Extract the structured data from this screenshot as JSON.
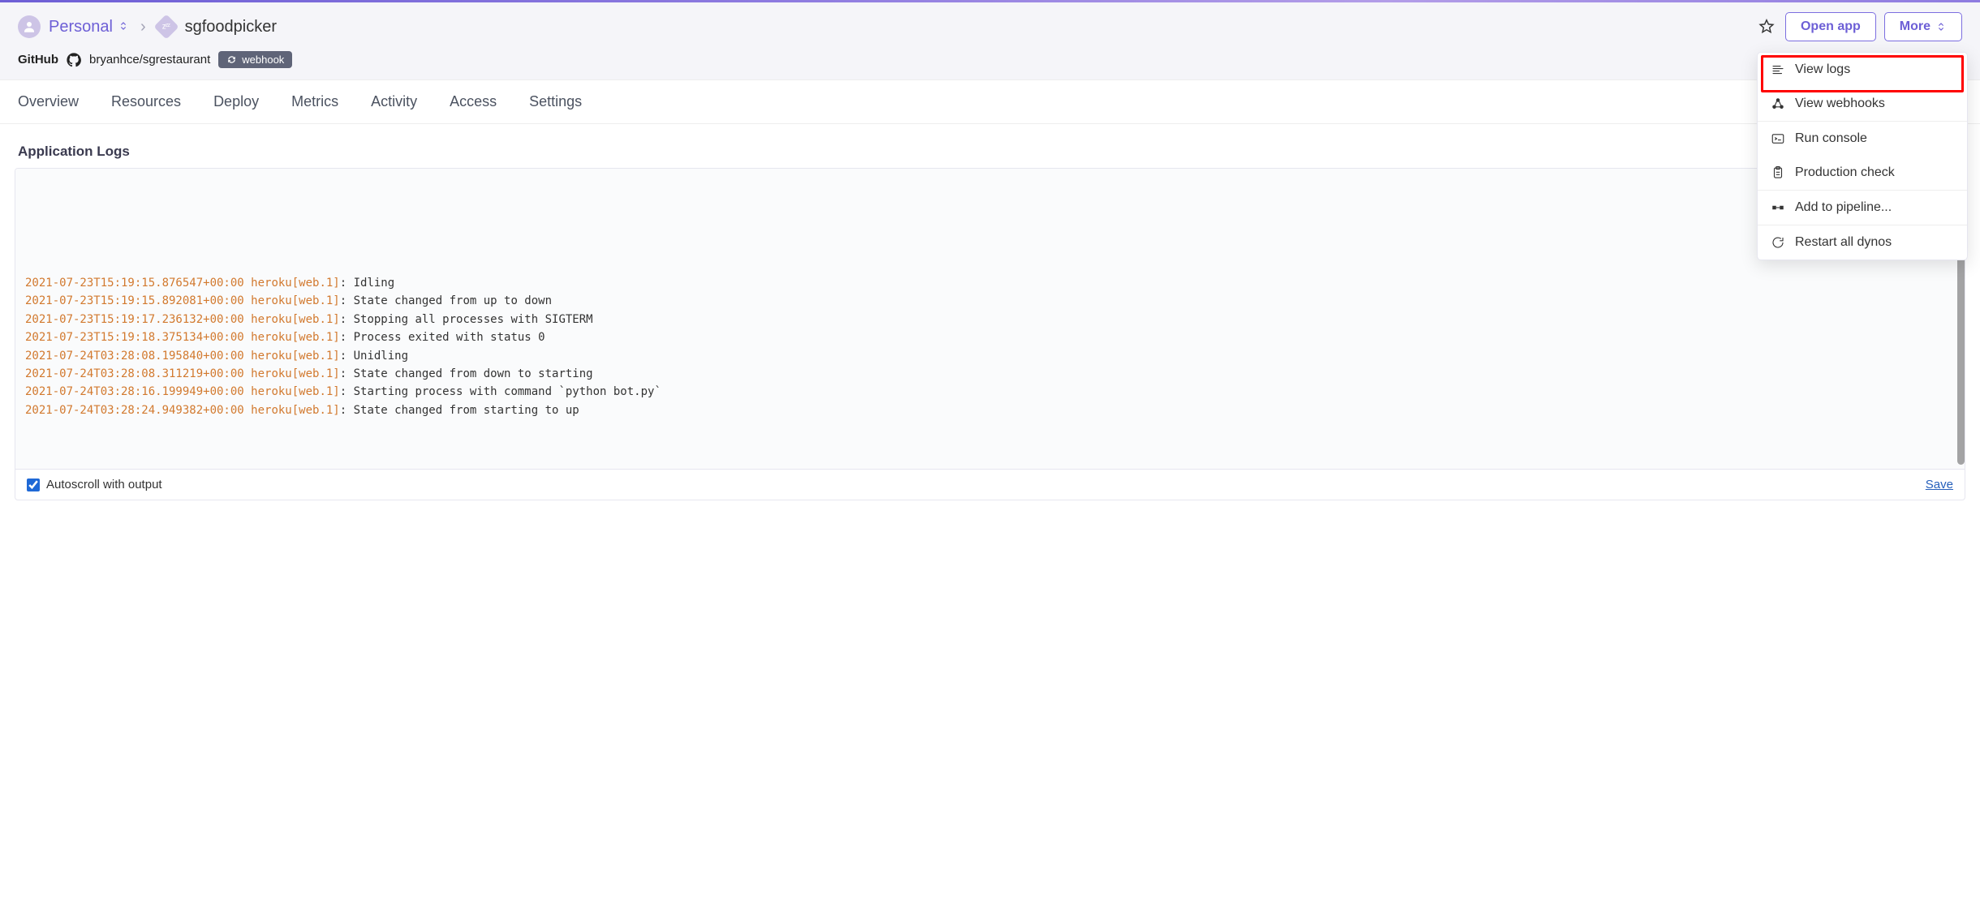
{
  "breadcrumb": {
    "team": "Personal",
    "app": "sgfoodpicker"
  },
  "header": {
    "github_label": "GitHub",
    "repo": "bryanhce/sgrestaurant",
    "webhook_pill": "webhook",
    "open_app_label": "Open app",
    "more_label": "More"
  },
  "tabs": [
    "Overview",
    "Resources",
    "Deploy",
    "Metrics",
    "Activity",
    "Access",
    "Settings"
  ],
  "page": {
    "title": "Application Logs"
  },
  "logs": [
    {
      "ts": "2021-07-23T15:19:15.876547+00:00",
      "src": "heroku[web.1]",
      "msg": "Idling"
    },
    {
      "ts": "2021-07-23T15:19:15.892081+00:00",
      "src": "heroku[web.1]",
      "msg": "State changed from up to down"
    },
    {
      "ts": "2021-07-23T15:19:17.236132+00:00",
      "src": "heroku[web.1]",
      "msg": "Stopping all processes with SIGTERM"
    },
    {
      "ts": "2021-07-23T15:19:18.375134+00:00",
      "src": "heroku[web.1]",
      "msg": "Process exited with status 0"
    },
    {
      "ts": "2021-07-24T03:28:08.195840+00:00",
      "src": "heroku[web.1]",
      "msg": "Unidling"
    },
    {
      "ts": "2021-07-24T03:28:08.311219+00:00",
      "src": "heroku[web.1]",
      "msg": "State changed from down to starting"
    },
    {
      "ts": "2021-07-24T03:28:16.199949+00:00",
      "src": "heroku[web.1]",
      "msg": "Starting process with command `python bot.py`"
    },
    {
      "ts": "2021-07-24T03:28:24.949382+00:00",
      "src": "heroku[web.1]",
      "msg": "State changed from starting to up"
    }
  ],
  "footer": {
    "autoscroll_label": "Autoscroll with output",
    "save_label": "Save"
  },
  "more_menu": {
    "view_logs": "View logs",
    "view_webhooks": "View webhooks",
    "run_console": "Run console",
    "production_check": "Production check",
    "add_to_pipeline": "Add to pipeline...",
    "restart_dynos": "Restart all dynos"
  }
}
